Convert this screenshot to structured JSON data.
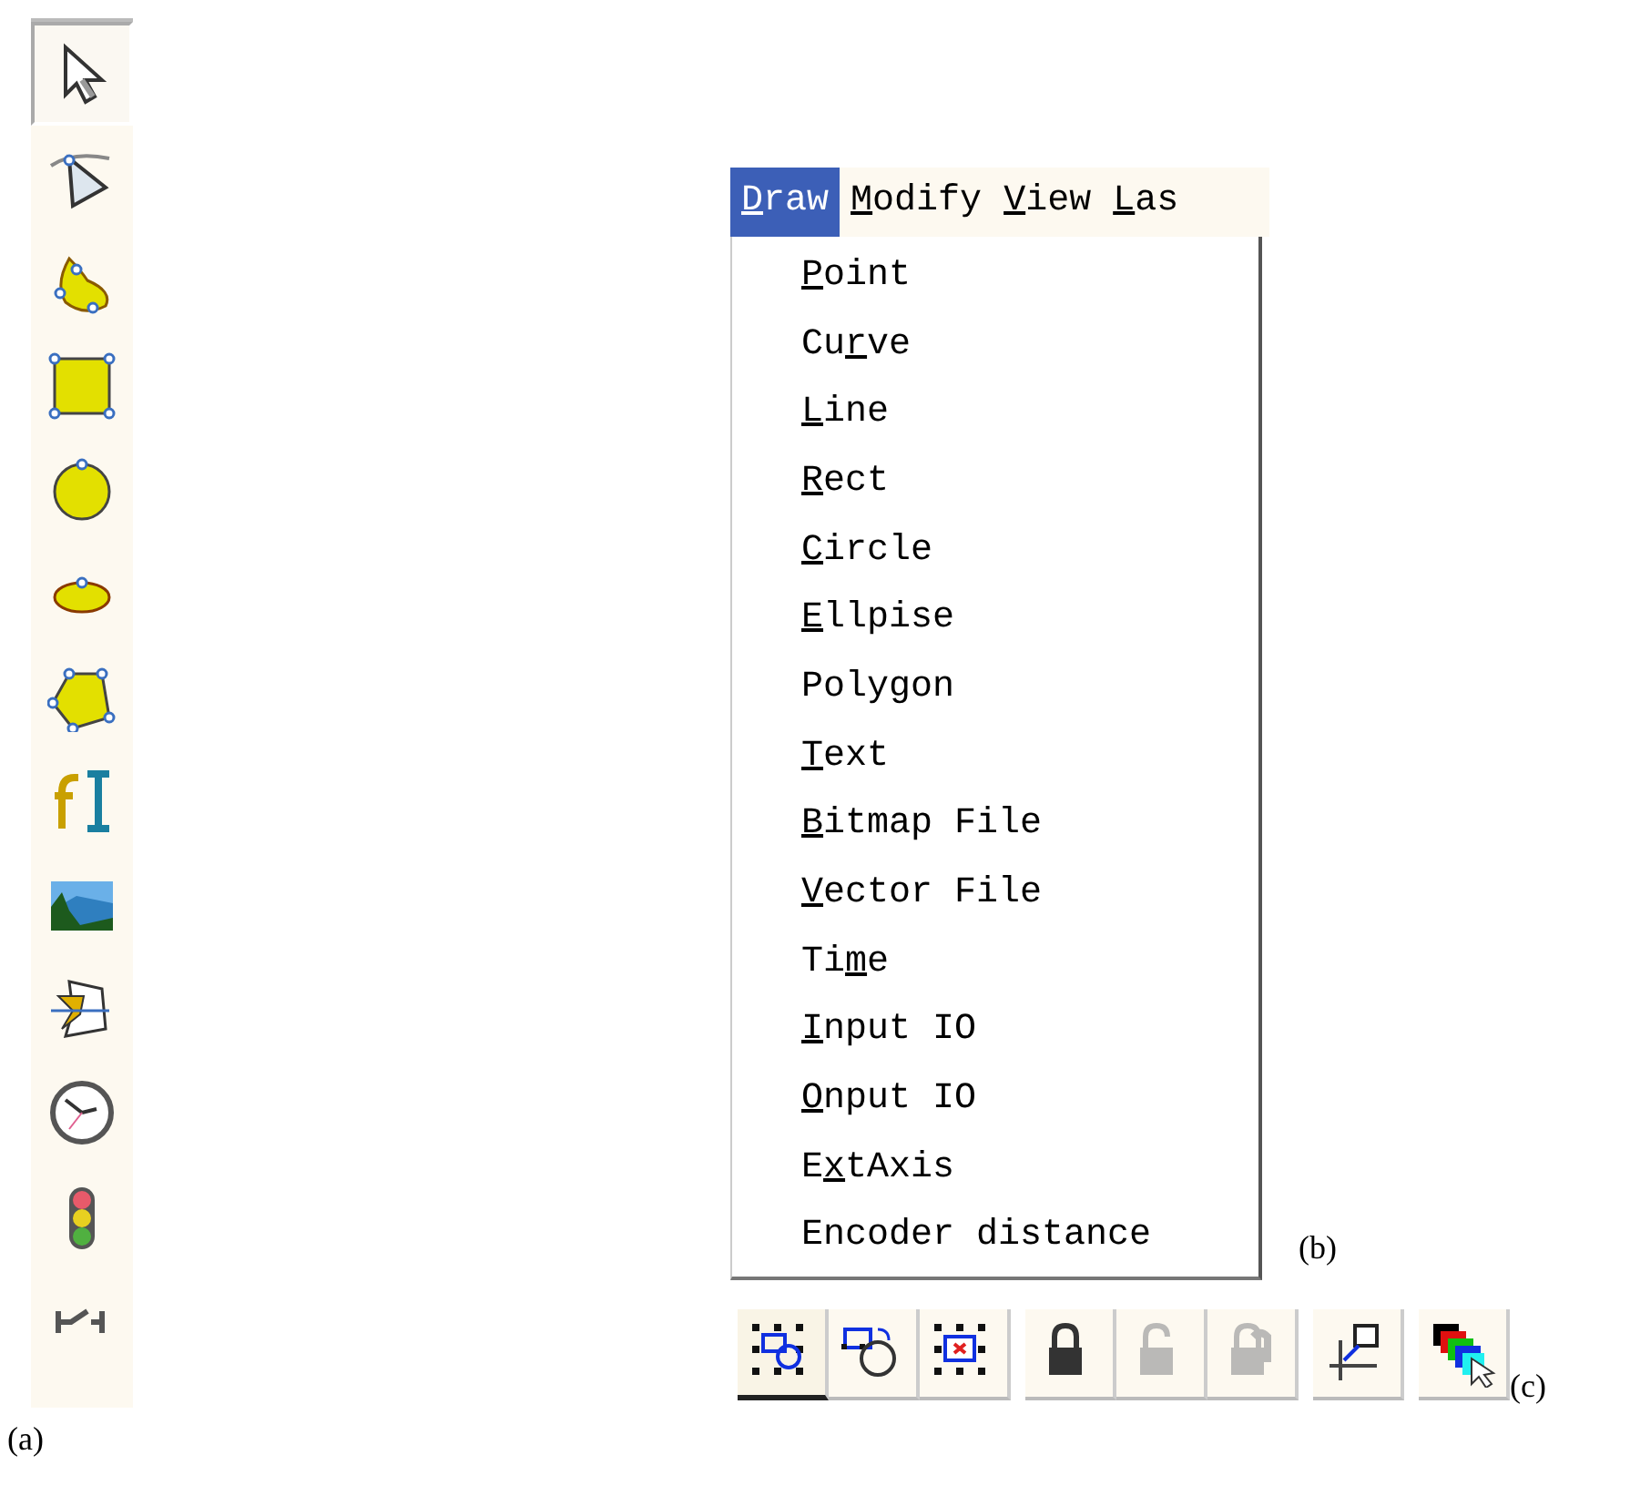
{
  "tool_palette": {
    "tools": [
      {
        "kind": "arrow",
        "selected": true
      },
      {
        "kind": "curve-arrow",
        "selected": false
      },
      {
        "kind": "blob",
        "selected": false
      },
      {
        "kind": "rect",
        "selected": false
      },
      {
        "kind": "circle",
        "selected": false
      },
      {
        "kind": "ellipse",
        "selected": false
      },
      {
        "kind": "polygon",
        "selected": false
      },
      {
        "kind": "text",
        "selected": false
      },
      {
        "kind": "picture",
        "selected": false
      },
      {
        "kind": "vector",
        "selected": false
      },
      {
        "kind": "clock",
        "selected": false
      },
      {
        "kind": "light",
        "selected": false
      },
      {
        "kind": "axis",
        "selected": false
      }
    ],
    "caption": "(a)"
  },
  "menu": {
    "bar": [
      {
        "key": "D",
        "after": "raw",
        "selected": true
      },
      {
        "key": "M",
        "after": "odify",
        "selected": false
      },
      {
        "key": "V",
        "after": "iew",
        "selected": false
      },
      {
        "key": "L",
        "after": "as",
        "selected": false
      }
    ],
    "items": [
      {
        "key": "P",
        "after": "oint"
      },
      {
        "before": "Cu",
        "key": "r",
        "after": "ve"
      },
      {
        "key": "L",
        "after": "ine"
      },
      {
        "key": "R",
        "after": "ect"
      },
      {
        "key": "C",
        "after": "ircle"
      },
      {
        "key": "E",
        "after": "llpise"
      },
      {
        "before": "Polygon"
      },
      {
        "key": "T",
        "after": "ext"
      },
      {
        "key": "B",
        "after": "itmap File"
      },
      {
        "key": "V",
        "after": "ector File"
      },
      {
        "before": "Ti",
        "key": "m",
        "after": "e"
      },
      {
        "key": "I",
        "after": "nput IO"
      },
      {
        "key": "O",
        "after": "nput IO"
      },
      {
        "before": "E",
        "key": "x",
        "after": "tAxis"
      },
      {
        "before": "Encoder distance"
      }
    ],
    "caption": "(b)"
  },
  "toolbar": {
    "buttons": [
      {
        "kind": "group",
        "pressed": true,
        "disabled": false
      },
      {
        "kind": "rotate",
        "pressed": false,
        "disabled": false
      },
      {
        "kind": "delete",
        "pressed": false,
        "disabled": false
      },
      {
        "kind": "lock",
        "pressed": false,
        "disabled": false
      },
      {
        "kind": "unlock",
        "pressed": false,
        "disabled": true
      },
      {
        "kind": "locks",
        "pressed": false,
        "disabled": true
      },
      {
        "kind": "origin",
        "pressed": false,
        "disabled": false
      },
      {
        "kind": "layers",
        "pressed": false,
        "disabled": false
      }
    ],
    "caption": "(c)"
  }
}
